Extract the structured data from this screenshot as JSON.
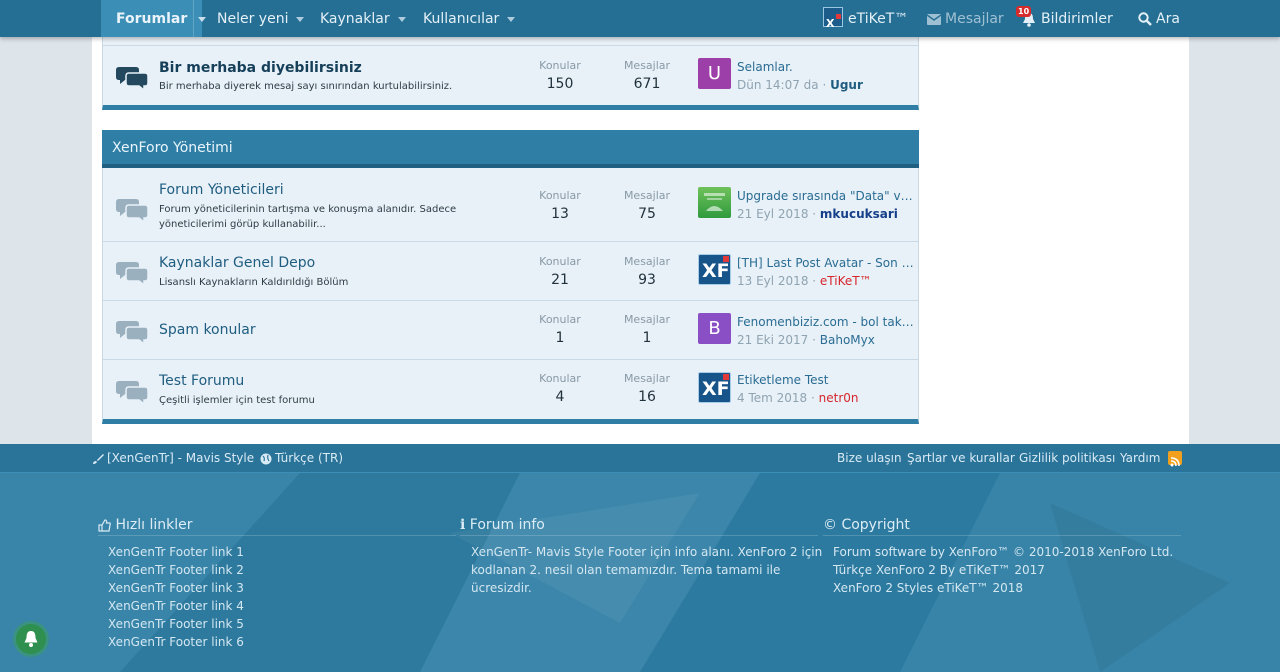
{
  "nav": {
    "tabs": [
      {
        "label": "Forumlar",
        "active": true
      },
      {
        "label": "Neler yeni"
      },
      {
        "label": "Kaynaklar"
      },
      {
        "label": "Kullanıcılar"
      }
    ],
    "brand": "eTiKeT™",
    "messages": "Mesajlar",
    "notifications": "Bildirimler",
    "notification_count": "10",
    "search": "Ara"
  },
  "top_node": {
    "title": "Bir merhaba diyebilirsiniz",
    "desc": "Bir merhaba diyerek mesaj sayı sınırından kurtulabilirsiniz.",
    "threads_label": "Konular",
    "threads": "150",
    "messages_label": "Mesajlar",
    "messages": "671",
    "last_title": "Selamlar.",
    "last_date": "Dün 14:07 da",
    "last_user": "Ugur",
    "avatar_letter": "U",
    "avatar_color": "#9c3fa8"
  },
  "section": {
    "title": "XenForo Yönetimi",
    "nodes": [
      {
        "title": "Forum Yöneticileri",
        "desc": "Forum yöneticilerinin tartışma ve konuşma alanıdır. Sadece yöneticilerimi görüp kullanabilir...",
        "threads_label": "Konular",
        "threads": "13",
        "messages_label": "Mesajlar",
        "messages": "75",
        "last_title": "Upgrade sırasında \"Data\" ve \"Internal_data\" klasörlerine ne olacak",
        "last_date": "21 Eyl 2018",
        "last_user": "mkucuksari",
        "user_color": "#163f8a",
        "avatar_type": "image-green"
      },
      {
        "title": "Kaynaklar Genel Depo",
        "desc": "Lisanslı Kaynakların Kaldırıldığı Bölüm",
        "threads_label": "Konular",
        "threads": "21",
        "messages_label": "Mesajlar",
        "messages": "93",
        "last_title": "[TH] Last Post Avatar - Son Mesaj Avatarı",
        "last_date": "13 Eyl 2018",
        "last_user": "eTiKeT™",
        "user_color": "#d6262b",
        "avatar_type": "xf"
      },
      {
        "title": "Spam konular",
        "desc": "",
        "threads_label": "Konular",
        "threads": "1",
        "messages_label": "Mesajlar",
        "messages": "1",
        "last_title": "Fenomenbiziz.com - bol takipçi",
        "last_date": "21 Eki 2017",
        "last_user": "BahoMyx",
        "user_color": "#2a6c93",
        "avatar_type": "letter",
        "avatar_letter": "B",
        "avatar_color": "#8a4fc4"
      },
      {
        "title": "Test Forumu",
        "desc": "Çeşitli işlemler için test forumu",
        "threads_label": "Konular",
        "threads": "4",
        "messages_label": "Mesajlar",
        "messages": "16",
        "last_title": "Etiketleme Test",
        "last_date": "4 Tem 2018",
        "last_user": "netr0n",
        "user_color": "#d6262b",
        "avatar_type": "xf"
      }
    ]
  },
  "footer_bar": {
    "style": "[XenGenTr] - Mavis Style",
    "language": "Türkçe (TR)",
    "links": [
      "Bize ulaşın",
      "Şartlar ve kurallar",
      "Gizlilik politikası",
      "Yardım"
    ]
  },
  "footer": {
    "quick_links_title": "Hızlı linkler",
    "quick_links": [
      "XenGenTr Footer link 1",
      "XenGenTr Footer link 2",
      "XenGenTr Footer link 3",
      "XenGenTr Footer link 4",
      "XenGenTr Footer link 5",
      "XenGenTr Footer link 6"
    ],
    "info_title": "Forum info",
    "info_lines": [
      "XenGenTr- Mavis Style Footer için info alanı. XenForo 2 için",
      "kodlanan 2. nesil olan temamızdır. Tema tamami ile",
      "ücresizdir."
    ],
    "copyright_title": "Copyright",
    "copyright_lines": [
      "Forum software by XenForo™ © 2010-2018 XenForo Ltd.",
      "Türkçe XenForo 2 By eTiKeT™ 2017",
      "XenForo 2 Styles eTiKeT™ 2018"
    ]
  }
}
